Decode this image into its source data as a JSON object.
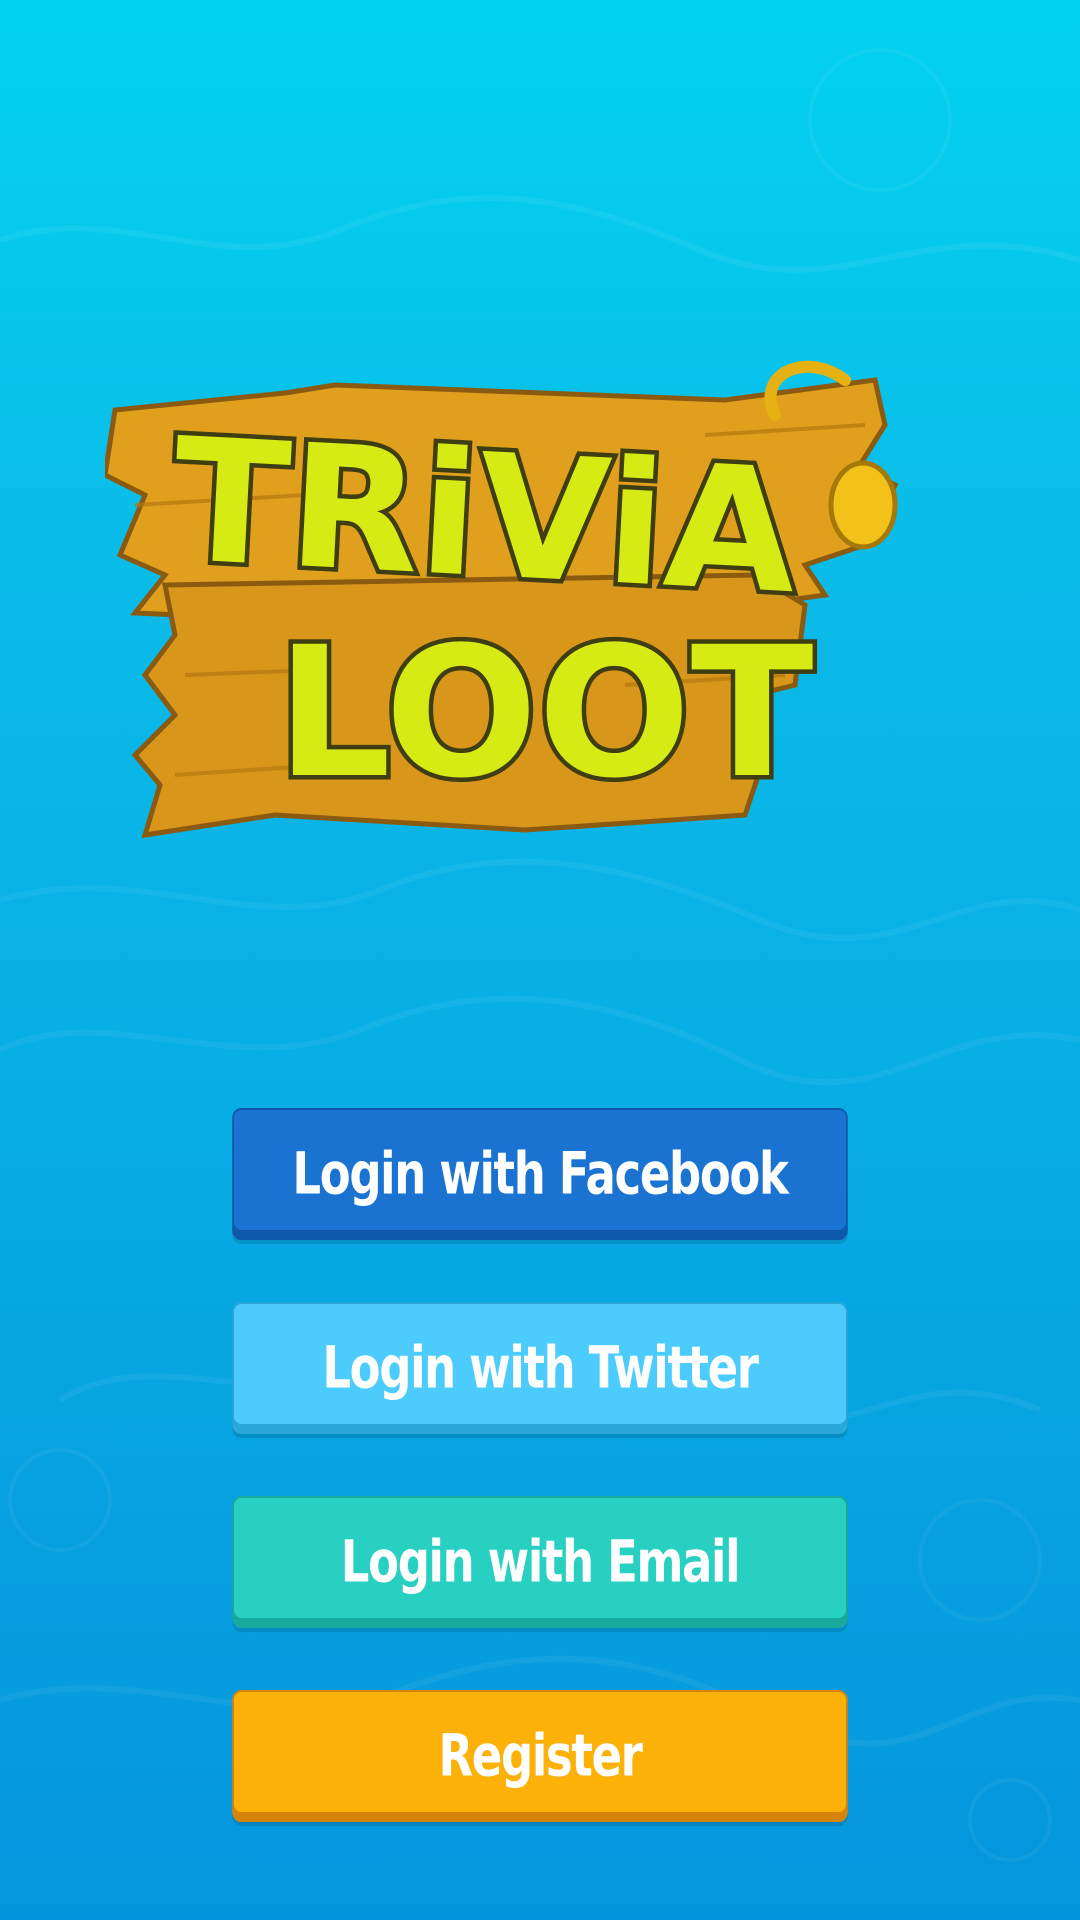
{
  "logo": {
    "line1": "TRiViA",
    "line2": "LOOT",
    "colors": {
      "wood": "#e0a01e",
      "wood_dark": "#8a5a10",
      "letters": "#d6ea14",
      "letters_shadow": "#7a8a0c",
      "hook": "#f2c21a"
    }
  },
  "buttons": [
    {
      "id": "facebook",
      "label": "Login with Facebook",
      "color": "#1a73d1",
      "shadow": "#0f59ad"
    },
    {
      "id": "twitter",
      "label": "Login with Twitter",
      "color": "#4cccfc",
      "shadow": "#2aa7d8"
    },
    {
      "id": "email",
      "label": "Login with Email",
      "color": "#27d0c1",
      "shadow": "#18a99c"
    },
    {
      "id": "register",
      "label": "Register",
      "color": "#fbb107",
      "shadow": "#d5840a"
    }
  ]
}
